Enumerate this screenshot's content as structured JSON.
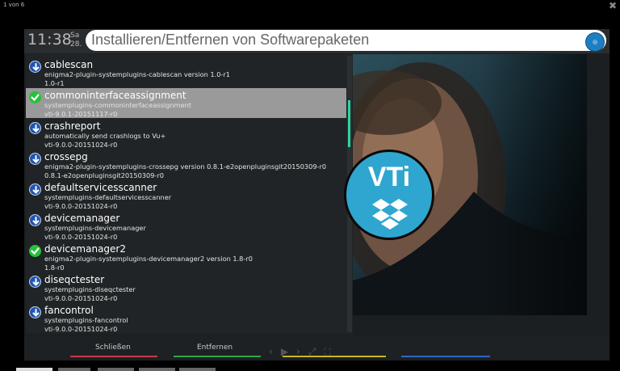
{
  "top": {
    "pager": "1 von 6"
  },
  "header": {
    "time": "11:38",
    "day": "Sa",
    "date": "28.",
    "title": "Installieren/Entfernen von Softwarepaketen"
  },
  "packages": [
    {
      "name": "cablescan",
      "desc": "enigma2-plugin-systemplugins-cablescan version 1.0-r1",
      "version": "1.0-r1",
      "icon": "download-icon",
      "selected": false
    },
    {
      "name": "commoninterfaceassignment",
      "desc": "systemplugins-commoninterfaceassignment",
      "version": "vti-9.0.1-20151117-r0",
      "icon": "installed-check-icon",
      "selected": true
    },
    {
      "name": "crashreport",
      "desc": "automatically send crashlogs to Vu+",
      "version": "vti-9.0.0-20151024-r0",
      "icon": "download-icon",
      "selected": false
    },
    {
      "name": "crossepg",
      "desc": "enigma2-plugin-systemplugins-crossepg version 0.8.1-e2openpluginsgit20150309-r0",
      "version": "0.8.1-e2openpluginsgit20150309-r0",
      "icon": "download-icon",
      "selected": false
    },
    {
      "name": "defaultservicesscanner",
      "desc": "systemplugins-defaultservicesscanner",
      "version": "vti-9.0.0-20151024-r0",
      "icon": "download-icon",
      "selected": false
    },
    {
      "name": "devicemanager",
      "desc": "systemplugins-devicemanager",
      "version": "vti-9.0.0-20151024-r0",
      "icon": "download-icon",
      "selected": false
    },
    {
      "name": "devicemanager2",
      "desc": "enigma2-plugin-systemplugins-devicemanager2 version 1.8-r0",
      "version": "1.8-r0",
      "icon": "installed-check-icon",
      "selected": false
    },
    {
      "name": "diseqctester",
      "desc": "systemplugins-diseqctester",
      "version": "vti-9.0.0-20151024-r0",
      "icon": "download-icon",
      "selected": false
    },
    {
      "name": "fancontrol",
      "desc": "systemplugins-fancontrol",
      "version": "vti-9.0.0-20151024-r0",
      "icon": "download-icon",
      "selected": false
    }
  ],
  "logo": {
    "text": "VTi",
    "icon": "dropbox-icon"
  },
  "footer": {
    "red_label": "Schließen",
    "green_label": "Entfernen",
    "colors": {
      "red": "#c8374e",
      "green": "#2aa84a",
      "yellow": "#c9b52a",
      "blue": "#2d68c4"
    }
  },
  "colors": {
    "accent": "#2fa6cf",
    "selected_row": "#9a9a9a",
    "scroll_thumb": "#2fd3a0"
  }
}
